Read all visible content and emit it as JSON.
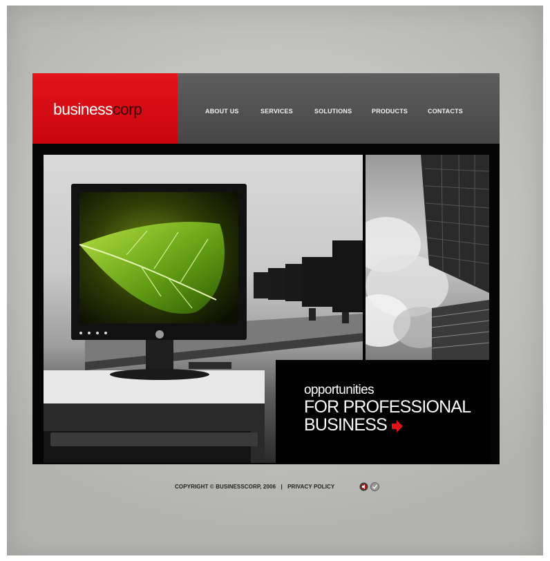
{
  "logo": {
    "part1": "business",
    "part2": "corp"
  },
  "nav": [
    {
      "label": "ABOUT US"
    },
    {
      "label": "SERVICES"
    },
    {
      "label": "SOLUTIONS"
    },
    {
      "label": "PRODUCTS"
    },
    {
      "label": "CONTACTS"
    }
  ],
  "hero": {
    "line1": "opportunities",
    "line2": "FOR PROFESSIONAL",
    "line3": "BUSINESS"
  },
  "footer": {
    "copyright": "COPYRIGHT © BUSINESSCORP, 2006",
    "separator": "|",
    "privacy": "PRIVACY POLICY"
  },
  "icons": {
    "hero_arrow": "red-arrow-icon",
    "footer_1": "sound-icon",
    "footer_2": "check-icon"
  },
  "colors": {
    "brand_red": "#d40c12",
    "header_gray": "#555555",
    "frame_black": "#050505"
  }
}
